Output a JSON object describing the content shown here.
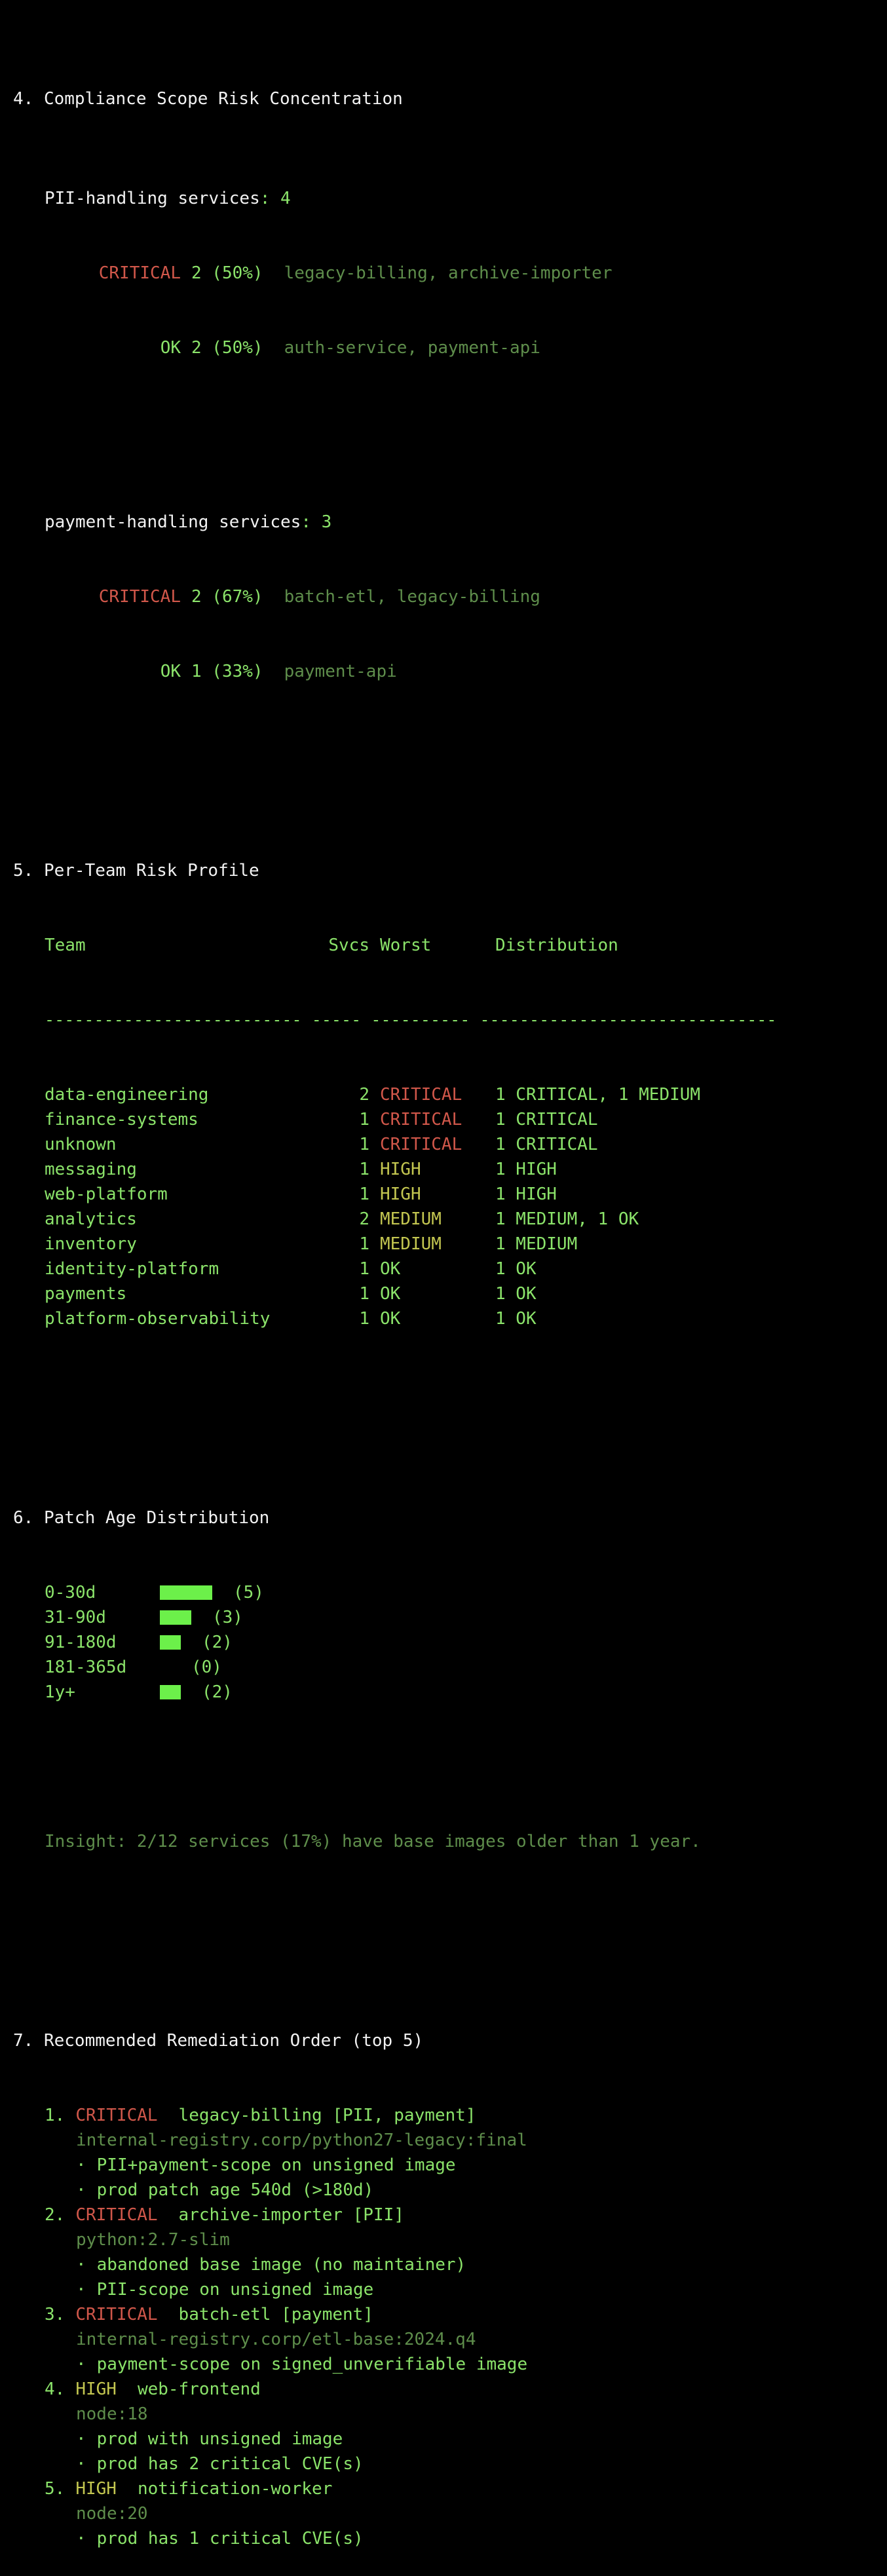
{
  "s4": {
    "heading": "4. Compliance Scope Risk Concentration",
    "groups": [
      {
        "label": "PII-handling services",
        "count": "4",
        "rows": [
          {
            "level": "CRITICAL",
            "stat": "2 (50%)",
            "services": "legacy-billing, archive-importer"
          },
          {
            "level": "OK",
            "stat": "2 (50%)",
            "services": "auth-service, payment-api"
          }
        ]
      },
      {
        "label": "payment-handling services",
        "count": "3",
        "rows": [
          {
            "level": "CRITICAL",
            "stat": "2 (67%)",
            "services": "batch-etl, legacy-billing"
          },
          {
            "level": "OK",
            "stat": "1 (33%)",
            "services": "payment-api"
          }
        ]
      }
    ]
  },
  "s5": {
    "heading": "5. Per-Team Risk Profile",
    "headers": {
      "team": "Team",
      "svcs": "Svcs",
      "worst": "Worst",
      "dist": "Distribution"
    },
    "rule": "-------------------------- ----- ---------- ------------------------------",
    "rows": [
      {
        "team": "data-engineering",
        "svcs": "2",
        "worst": "CRITICAL",
        "dist": "1 CRITICAL, 1 MEDIUM"
      },
      {
        "team": "finance-systems",
        "svcs": "1",
        "worst": "CRITICAL",
        "dist": "1 CRITICAL"
      },
      {
        "team": "unknown",
        "svcs": "1",
        "worst": "CRITICAL",
        "dist": "1 CRITICAL"
      },
      {
        "team": "messaging",
        "svcs": "1",
        "worst": "HIGH",
        "dist": "1 HIGH"
      },
      {
        "team": "web-platform",
        "svcs": "1",
        "worst": "HIGH",
        "dist": "1 HIGH"
      },
      {
        "team": "analytics",
        "svcs": "2",
        "worst": "MEDIUM",
        "dist": "1 MEDIUM, 1 OK"
      },
      {
        "team": "inventory",
        "svcs": "1",
        "worst": "MEDIUM",
        "dist": "1 MEDIUM"
      },
      {
        "team": "identity-platform",
        "svcs": "1",
        "worst": "OK",
        "dist": "1 OK"
      },
      {
        "team": "payments",
        "svcs": "1",
        "worst": "OK",
        "dist": "1 OK"
      },
      {
        "team": "platform-observability",
        "svcs": "1",
        "worst": "OK",
        "dist": "1 OK"
      }
    ]
  },
  "s6": {
    "heading": "6. Patch Age Distribution",
    "buckets": [
      {
        "label": "0-30d",
        "count": 5,
        "count_text": "(5)"
      },
      {
        "label": "31-90d",
        "count": 3,
        "count_text": "(3)"
      },
      {
        "label": "91-180d",
        "count": 2,
        "count_text": "(2)"
      },
      {
        "label": "181-365d",
        "count": 0,
        "count_text": "(0)"
      },
      {
        "label": "1y+",
        "count": 2,
        "count_text": "(2)"
      }
    ],
    "insight": "Insight: 2/12 services (17%) have base images older than 1 year."
  },
  "s7": {
    "heading": "7. Recommended Remediation Order (top 5)",
    "items": [
      {
        "num": "1.",
        "level": "CRITICAL",
        "service": "legacy-billing [PII, payment]",
        "image": "internal-registry.corp/python27-legacy:final",
        "reasons": [
          "PII+payment-scope on unsigned image",
          "prod patch age 540d (>180d)"
        ]
      },
      {
        "num": "2.",
        "level": "CRITICAL",
        "service": "archive-importer [PII]",
        "image": "python:2.7-slim",
        "reasons": [
          "abandoned base image (no maintainer)",
          "PII-scope on unsigned image"
        ]
      },
      {
        "num": "3.",
        "level": "CRITICAL",
        "service": "batch-etl [payment]",
        "image": "internal-registry.corp/etl-base:2024.q4",
        "reasons": [
          "payment-scope on signed_unverifiable image"
        ]
      },
      {
        "num": "4.",
        "level": "HIGH",
        "service": "web-frontend",
        "image": "node:18",
        "reasons": [
          "prod with unsigned image",
          "prod has 2 critical CVE(s)"
        ]
      },
      {
        "num": "5.",
        "level": "HIGH",
        "service": "notification-worker",
        "image": "node:20",
        "reasons": [
          "prod has 1 critical CVE(s)"
        ]
      }
    ]
  },
  "colors": {
    "background": "#000000",
    "green": "#8be36a",
    "dim_green": "#5e8d4b",
    "critical": "#d0574a",
    "high_medium": "#c3c650",
    "heading": "#f2f2f2",
    "bar": "#6cf04a"
  },
  "bullet": "·"
}
